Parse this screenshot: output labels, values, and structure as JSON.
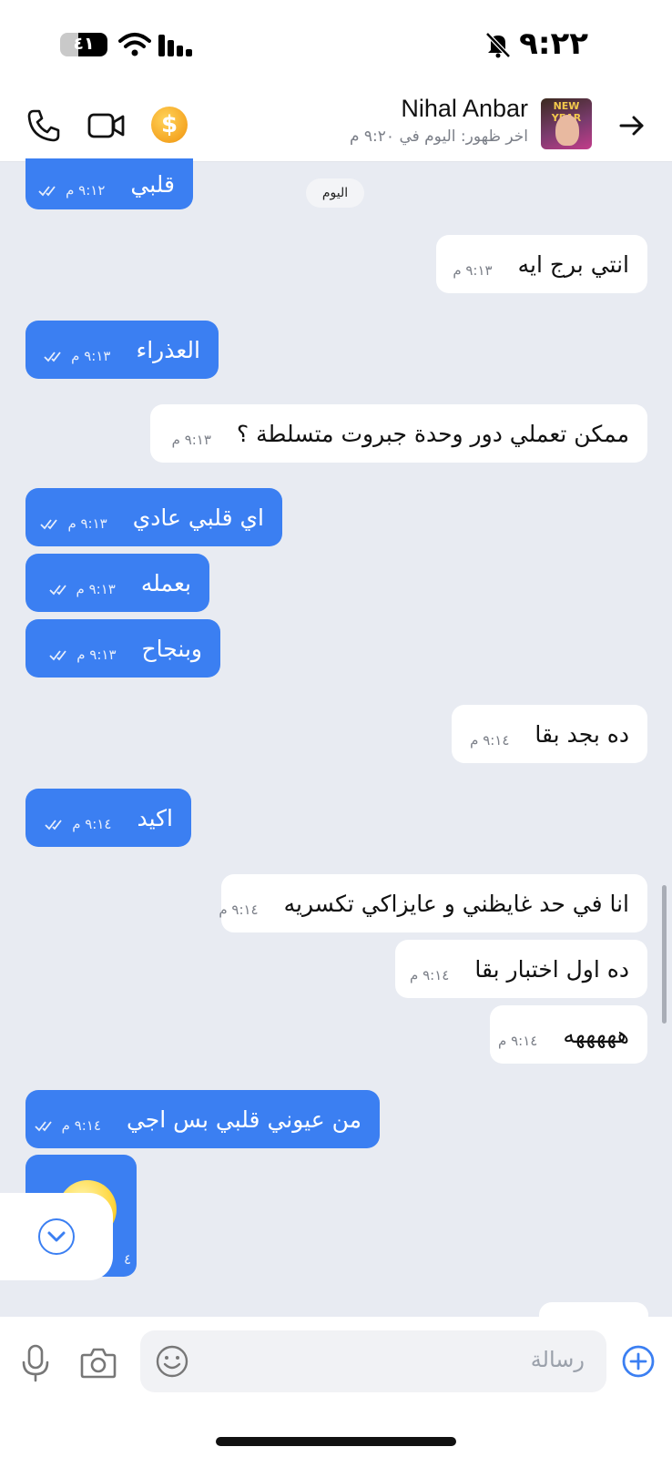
{
  "status_bar": {
    "time": "٩:٢٢",
    "battery": "٤١"
  },
  "header": {
    "contact_name": "Nihal Anbar",
    "last_seen": "اخر ظهور: اليوم في ٩:٢٠ م",
    "avatar_banner": "NEW YEAR",
    "coin_symbol": "$"
  },
  "chat": {
    "day_label": "اليوم",
    "messages": [
      {
        "dir": "out",
        "text": "قلبي",
        "time": "٩:١٢ م"
      },
      {
        "dir": "in",
        "text": "انتي برج ايه",
        "time": "٩:١٣ م"
      },
      {
        "dir": "out",
        "text": "العذراء",
        "time": "٩:١٣ م"
      },
      {
        "dir": "in",
        "text": "ممكن تعملي دور وحدة جبروت متسلطة ؟",
        "time": "٩:١٣ م"
      },
      {
        "dir": "out",
        "text": "اي قلبي عادي",
        "time": "٩:١٣ م"
      },
      {
        "dir": "out",
        "text": "بعمله",
        "time": "٩:١٣ م"
      },
      {
        "dir": "out",
        "text": "وبنجاح",
        "time": "٩:١٣ م"
      },
      {
        "dir": "in",
        "text": "ده بجد بقا",
        "time": "٩:١٤ م"
      },
      {
        "dir": "out",
        "text": "اكيد",
        "time": "٩:١٤ م"
      },
      {
        "dir": "in",
        "text": "انا في حد غايظني و عايزاكي تكسريه",
        "time": "٩:١٤ م"
      },
      {
        "dir": "in",
        "text": "ده اول اختبار بقا",
        "time": "٩:١٤ م"
      },
      {
        "dir": "in",
        "text": "هههههه",
        "time": "٩:١٤ م"
      },
      {
        "dir": "out",
        "text": "من عيوني قلبي بس اجي",
        "time": "٩:١٤ م"
      }
    ],
    "sticker_time_fragment": "٤"
  },
  "input_bar": {
    "placeholder": "رسالة"
  },
  "colors": {
    "accent": "#3b7ff2",
    "chat_background": "#e8ebf2",
    "incoming_bubble": "#ffffff"
  },
  "icons": [
    "bell-muted-icon",
    "wifi-icon",
    "signal-icon",
    "phone-icon",
    "video-icon",
    "coin-icon",
    "back-arrow-icon",
    "chevron-down-icon",
    "mic-icon",
    "camera-icon",
    "emoji-icon",
    "plus-icon"
  ]
}
